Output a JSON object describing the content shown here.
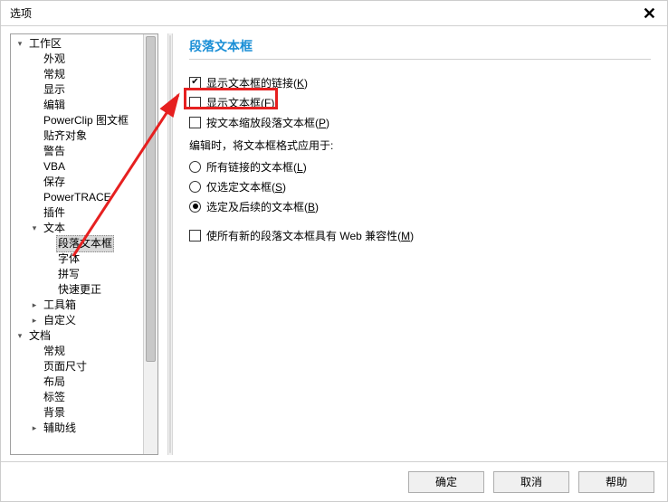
{
  "titlebar": {
    "title": "选项"
  },
  "tree": {
    "root0": {
      "label": "工作区"
    },
    "items1": [
      {
        "label": "外观"
      },
      {
        "label": "常规"
      },
      {
        "label": "显示"
      },
      {
        "label": "编辑"
      },
      {
        "label": "PowerClip 图文框"
      },
      {
        "label": "贴齐对象"
      },
      {
        "label": "警告"
      },
      {
        "label": "VBA"
      },
      {
        "label": "保存"
      },
      {
        "label": "PowerTRACE"
      },
      {
        "label": "插件"
      }
    ],
    "text_group": {
      "label": "文本"
    },
    "text_children": [
      {
        "label": "段落文本框",
        "selected": true
      },
      {
        "label": "字体"
      },
      {
        "label": "拼写"
      },
      {
        "label": "快速更正"
      }
    ],
    "toolbox": {
      "label": "工具箱"
    },
    "custom": {
      "label": "自定义"
    },
    "doc": {
      "label": "文档"
    },
    "doc_children": [
      {
        "label": "常规"
      },
      {
        "label": "页面尺寸"
      },
      {
        "label": "布局"
      },
      {
        "label": "标签"
      },
      {
        "label": "背景"
      }
    ],
    "guides": {
      "label": "辅助线"
    }
  },
  "panel": {
    "heading": "段落文本框",
    "cb1": {
      "label_pre": "显示文本框的链接(",
      "mn": "K",
      "label_post": ")",
      "checked": true
    },
    "cb2": {
      "label_pre": "显示文本框(",
      "mn": "F",
      "label_post": ")",
      "checked": false
    },
    "cb3": {
      "label_pre": "按文本缩放段落文本框(",
      "mn": "P",
      "label_post": ")",
      "checked": false
    },
    "group_label": "编辑时，将文本框格式应用于:",
    "r1": {
      "label_pre": "所有链接的文本框(",
      "mn": "L",
      "label_post": ")"
    },
    "r2": {
      "label_pre": "仅选定文本框(",
      "mn": "S",
      "label_post": ")"
    },
    "r3": {
      "label_pre": "选定及后续的文本框(",
      "mn": "B",
      "label_post": ")",
      "selected": true
    },
    "cb4": {
      "label_pre": "使所有新的段落文本框具有 Web 兼容性(",
      "mn": "M",
      "label_post": ")",
      "checked": false
    }
  },
  "footer": {
    "ok": "确定",
    "cancel": "取消",
    "help": "帮助"
  }
}
